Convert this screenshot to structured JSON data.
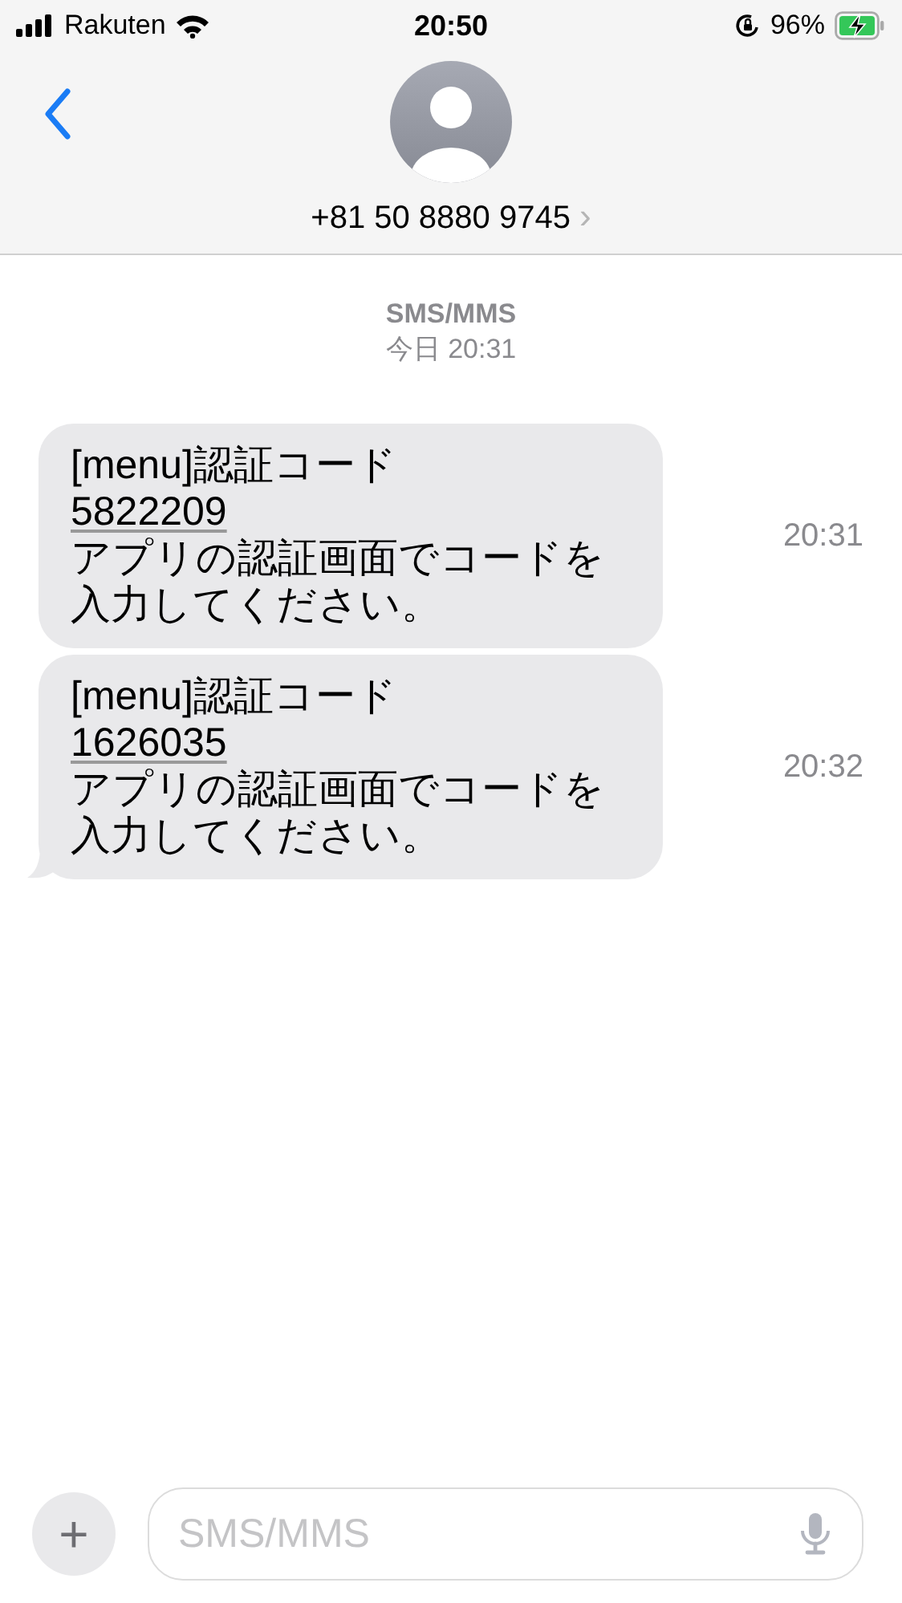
{
  "status_bar": {
    "carrier": "Rakuten",
    "time": "20:50",
    "battery_percent": "96%",
    "charging": true
  },
  "header": {
    "contact": "+81 50 8880 9745",
    "chevron": "›"
  },
  "service_label": "SMS/MMS",
  "date_label": "今日 20:31",
  "messages": [
    {
      "title": "[menu]認証コード",
      "code": "5822209",
      "body": "アプリの認証画面でコードを入力してください。",
      "time": "20:31",
      "tail": false
    },
    {
      "title": "[menu]認証コード",
      "code": "1626035",
      "body": "アプリの認証画面でコードを入力してください。",
      "time": "20:32",
      "tail": true
    }
  ],
  "composer": {
    "placeholder": "SMS/MMS",
    "plus": "+"
  }
}
